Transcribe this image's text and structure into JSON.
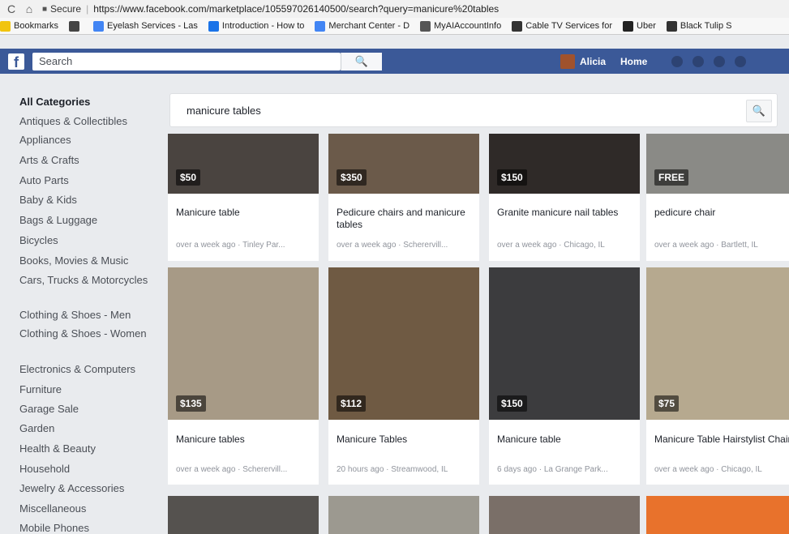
{
  "browser": {
    "nav_back": "C",
    "nav_home": "⌂",
    "secure_label": "Secure",
    "url": "https://www.facebook.com/marketplace/105597026140500/search?query=manicure%20tables",
    "bookmarks": [
      {
        "label": "Bookmarks",
        "icon": "star-icon",
        "color": "#f1c40f"
      },
      {
        "label": "",
        "icon": "yelp-icon",
        "color": "#444444"
      },
      {
        "label": "Eyelash Services - Las",
        "icon": "google-icon",
        "color": "#4285f4"
      },
      {
        "label": "Introduction - How to",
        "icon": "cloud-icon",
        "color": "#1a73e8"
      },
      {
        "label": "Merchant Center - D",
        "icon": "google-icon",
        "color": "#4285f4"
      },
      {
        "label": "MyAIAccountInfo",
        "icon": "globe-icon",
        "color": "#555555"
      },
      {
        "label": "Cable TV Services for",
        "icon": "s-icon",
        "color": "#333333"
      },
      {
        "label": "Uber",
        "icon": "uber-icon",
        "color": "#222222"
      },
      {
        "label": "Black Tulip S",
        "icon": "r-icon",
        "color": "#333333"
      }
    ]
  },
  "fb": {
    "logo": "f",
    "search_placeholder": "Search",
    "search_icon": "🔍",
    "user_name": "Alicia",
    "home_label": "Home"
  },
  "sidebar": {
    "categories": [
      "All Categories",
      "Antiques & Collectibles",
      "Appliances",
      "Arts & Crafts",
      "Auto Parts",
      "Baby & Kids",
      "Bags & Luggage",
      "Bicycles",
      "Books, Movies & Music",
      "Cars, Trucks & Motorcycles",
      "Clothing & Shoes - Men",
      "Clothing & Shoes - Women",
      "Electronics & Computers",
      "Furniture",
      "Garage Sale",
      "Garden",
      "Health & Beauty",
      "Household",
      "Jewelry & Accessories",
      "Miscellaneous",
      "Mobile Phones"
    ]
  },
  "search": {
    "query": "manicure tables",
    "icon": "🔍"
  },
  "listings": [
    {
      "price": "$50",
      "title": "Manicure table",
      "meta": "over a week ago · Tinley Par...",
      "color": "#4a4440"
    },
    {
      "price": "$350",
      "title": "Pedicure chairs and manicure tables",
      "meta": "over a week ago · Scherervill...",
      "color": "#6b5a4a"
    },
    {
      "price": "$150",
      "title": "Granite manicure nail tables",
      "meta": "over a week ago · Chicago, IL",
      "color": "#2f2a28"
    },
    {
      "price": "FREE",
      "title": "pedicure chair",
      "meta": "over a week ago · Bartlett, IL",
      "color": "#8a8a86"
    },
    {
      "price": "$135",
      "title": "Manicure tables",
      "meta": "over a week ago · Scherervill...",
      "color": "#a79a86"
    },
    {
      "price": "$112",
      "title": "Manicure Tables",
      "meta": "20 hours ago · Streamwood, IL",
      "color": "#6f5a43"
    },
    {
      "price": "$150",
      "title": "Manicure table",
      "meta": "6 days ago · La Grange Park...",
      "color": "#3c3c3e"
    },
    {
      "price": "$75",
      "title": "Manicure Table Hairstylist Chair",
      "meta": "over a week ago · Chicago, IL",
      "color": "#b6a98f"
    },
    {
      "price": "",
      "title": "",
      "meta": "",
      "color": "#55524f"
    },
    {
      "price": "",
      "title": "",
      "meta": "",
      "color": "#9c9990"
    },
    {
      "price": "",
      "title": "",
      "meta": "",
      "color": "#7a6f68"
    },
    {
      "price": "",
      "title": "",
      "meta": "",
      "color": "#e8722c"
    }
  ]
}
